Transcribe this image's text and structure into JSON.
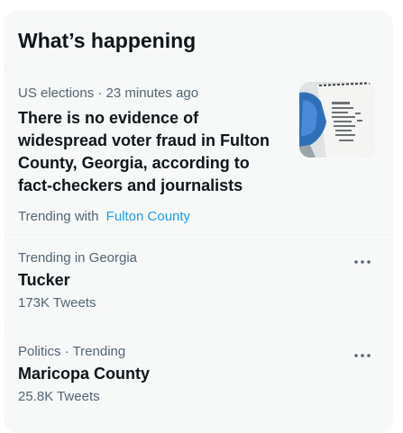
{
  "panel": {
    "title": "What’s happening"
  },
  "trends": [
    {
      "meta": "US elections · 23 minutes ago",
      "headline": "There is no evidence of widespread voter fraud in Fulton County, Georgia, according to fact-checkers and journalists",
      "trending_with_label": "Trending with",
      "trending_with_link": "Fulton County"
    },
    {
      "meta": "Trending in Georgia",
      "name": "Tucker",
      "count": "173K Tweets",
      "more_icon": "more-horizontal-icon"
    },
    {
      "meta": "Politics · Trending",
      "name": "Maricopa County",
      "count": "25.8K Tweets",
      "more_icon": "more-horizontal-icon"
    }
  ],
  "colors": {
    "accent": "#1d9bf0",
    "panel_bg": "#f7f9f9",
    "secondary_text": "#536471",
    "primary_text": "#0f1419"
  }
}
